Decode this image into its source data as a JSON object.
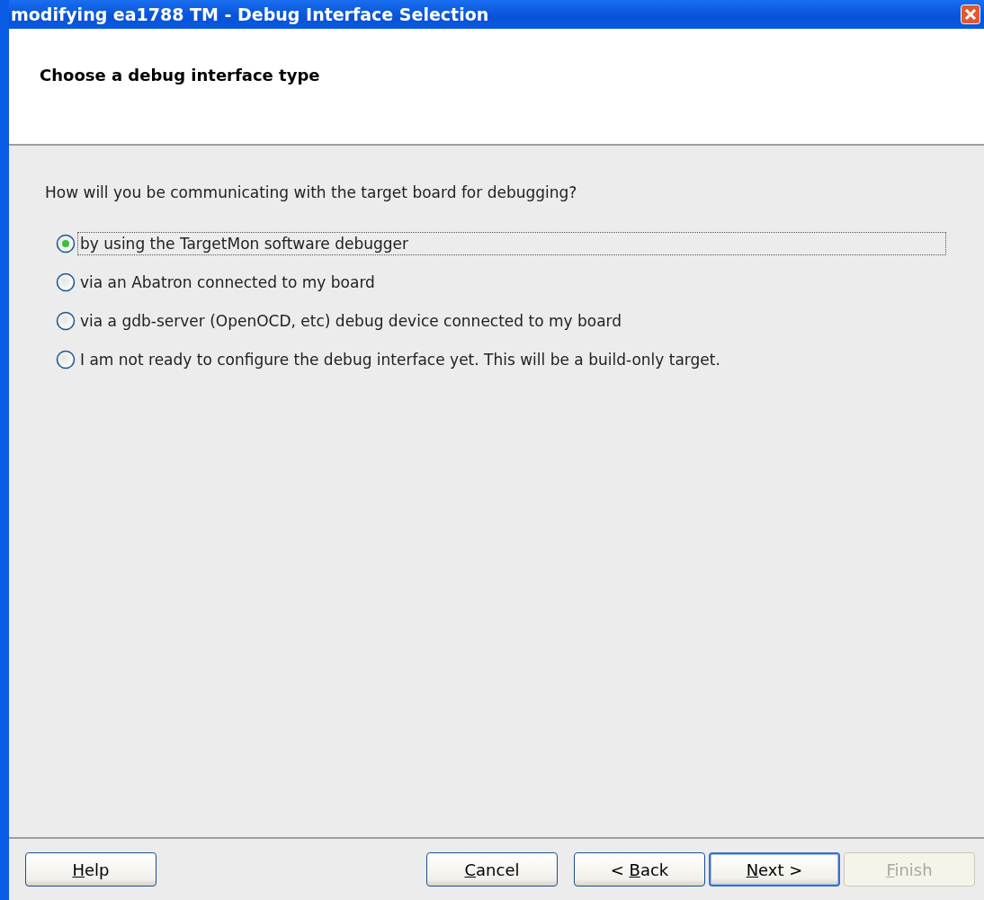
{
  "window": {
    "title": "modifying ea1788 TM - Debug Interface Selection"
  },
  "header": {
    "title": "Choose a debug interface type"
  },
  "question": "How will you be communicating with the target board for debugging?",
  "options": [
    {
      "label": "by using the TargetMon software debugger",
      "selected": true,
      "focused": true
    },
    {
      "label": "via an Abatron connected to my board",
      "selected": false,
      "focused": false
    },
    {
      "label": "via a gdb-server (OpenOCD, etc) debug device connected to my board",
      "selected": false,
      "focused": false
    },
    {
      "label": "I am not ready to configure the debug interface yet. This will be a build-only target.",
      "selected": false,
      "focused": false
    }
  ],
  "buttons": [
    {
      "access_key": "H",
      "label_rest": "elp",
      "disabled": false,
      "default": false,
      "kind": "left"
    },
    {
      "access_key": "C",
      "label_rest": "ancel",
      "disabled": false,
      "default": false,
      "kind": "right"
    },
    {
      "label_start": "< ",
      "access_key": "B",
      "label_rest": "ack",
      "disabled": false,
      "default": false,
      "kind": "right"
    },
    {
      "access_key": "N",
      "label_rest": "ext >",
      "disabled": false,
      "default": true,
      "kind": "right"
    },
    {
      "access_key": "F",
      "label_rest": "inish",
      "disabled": true,
      "default": false,
      "kind": "right"
    }
  ]
}
